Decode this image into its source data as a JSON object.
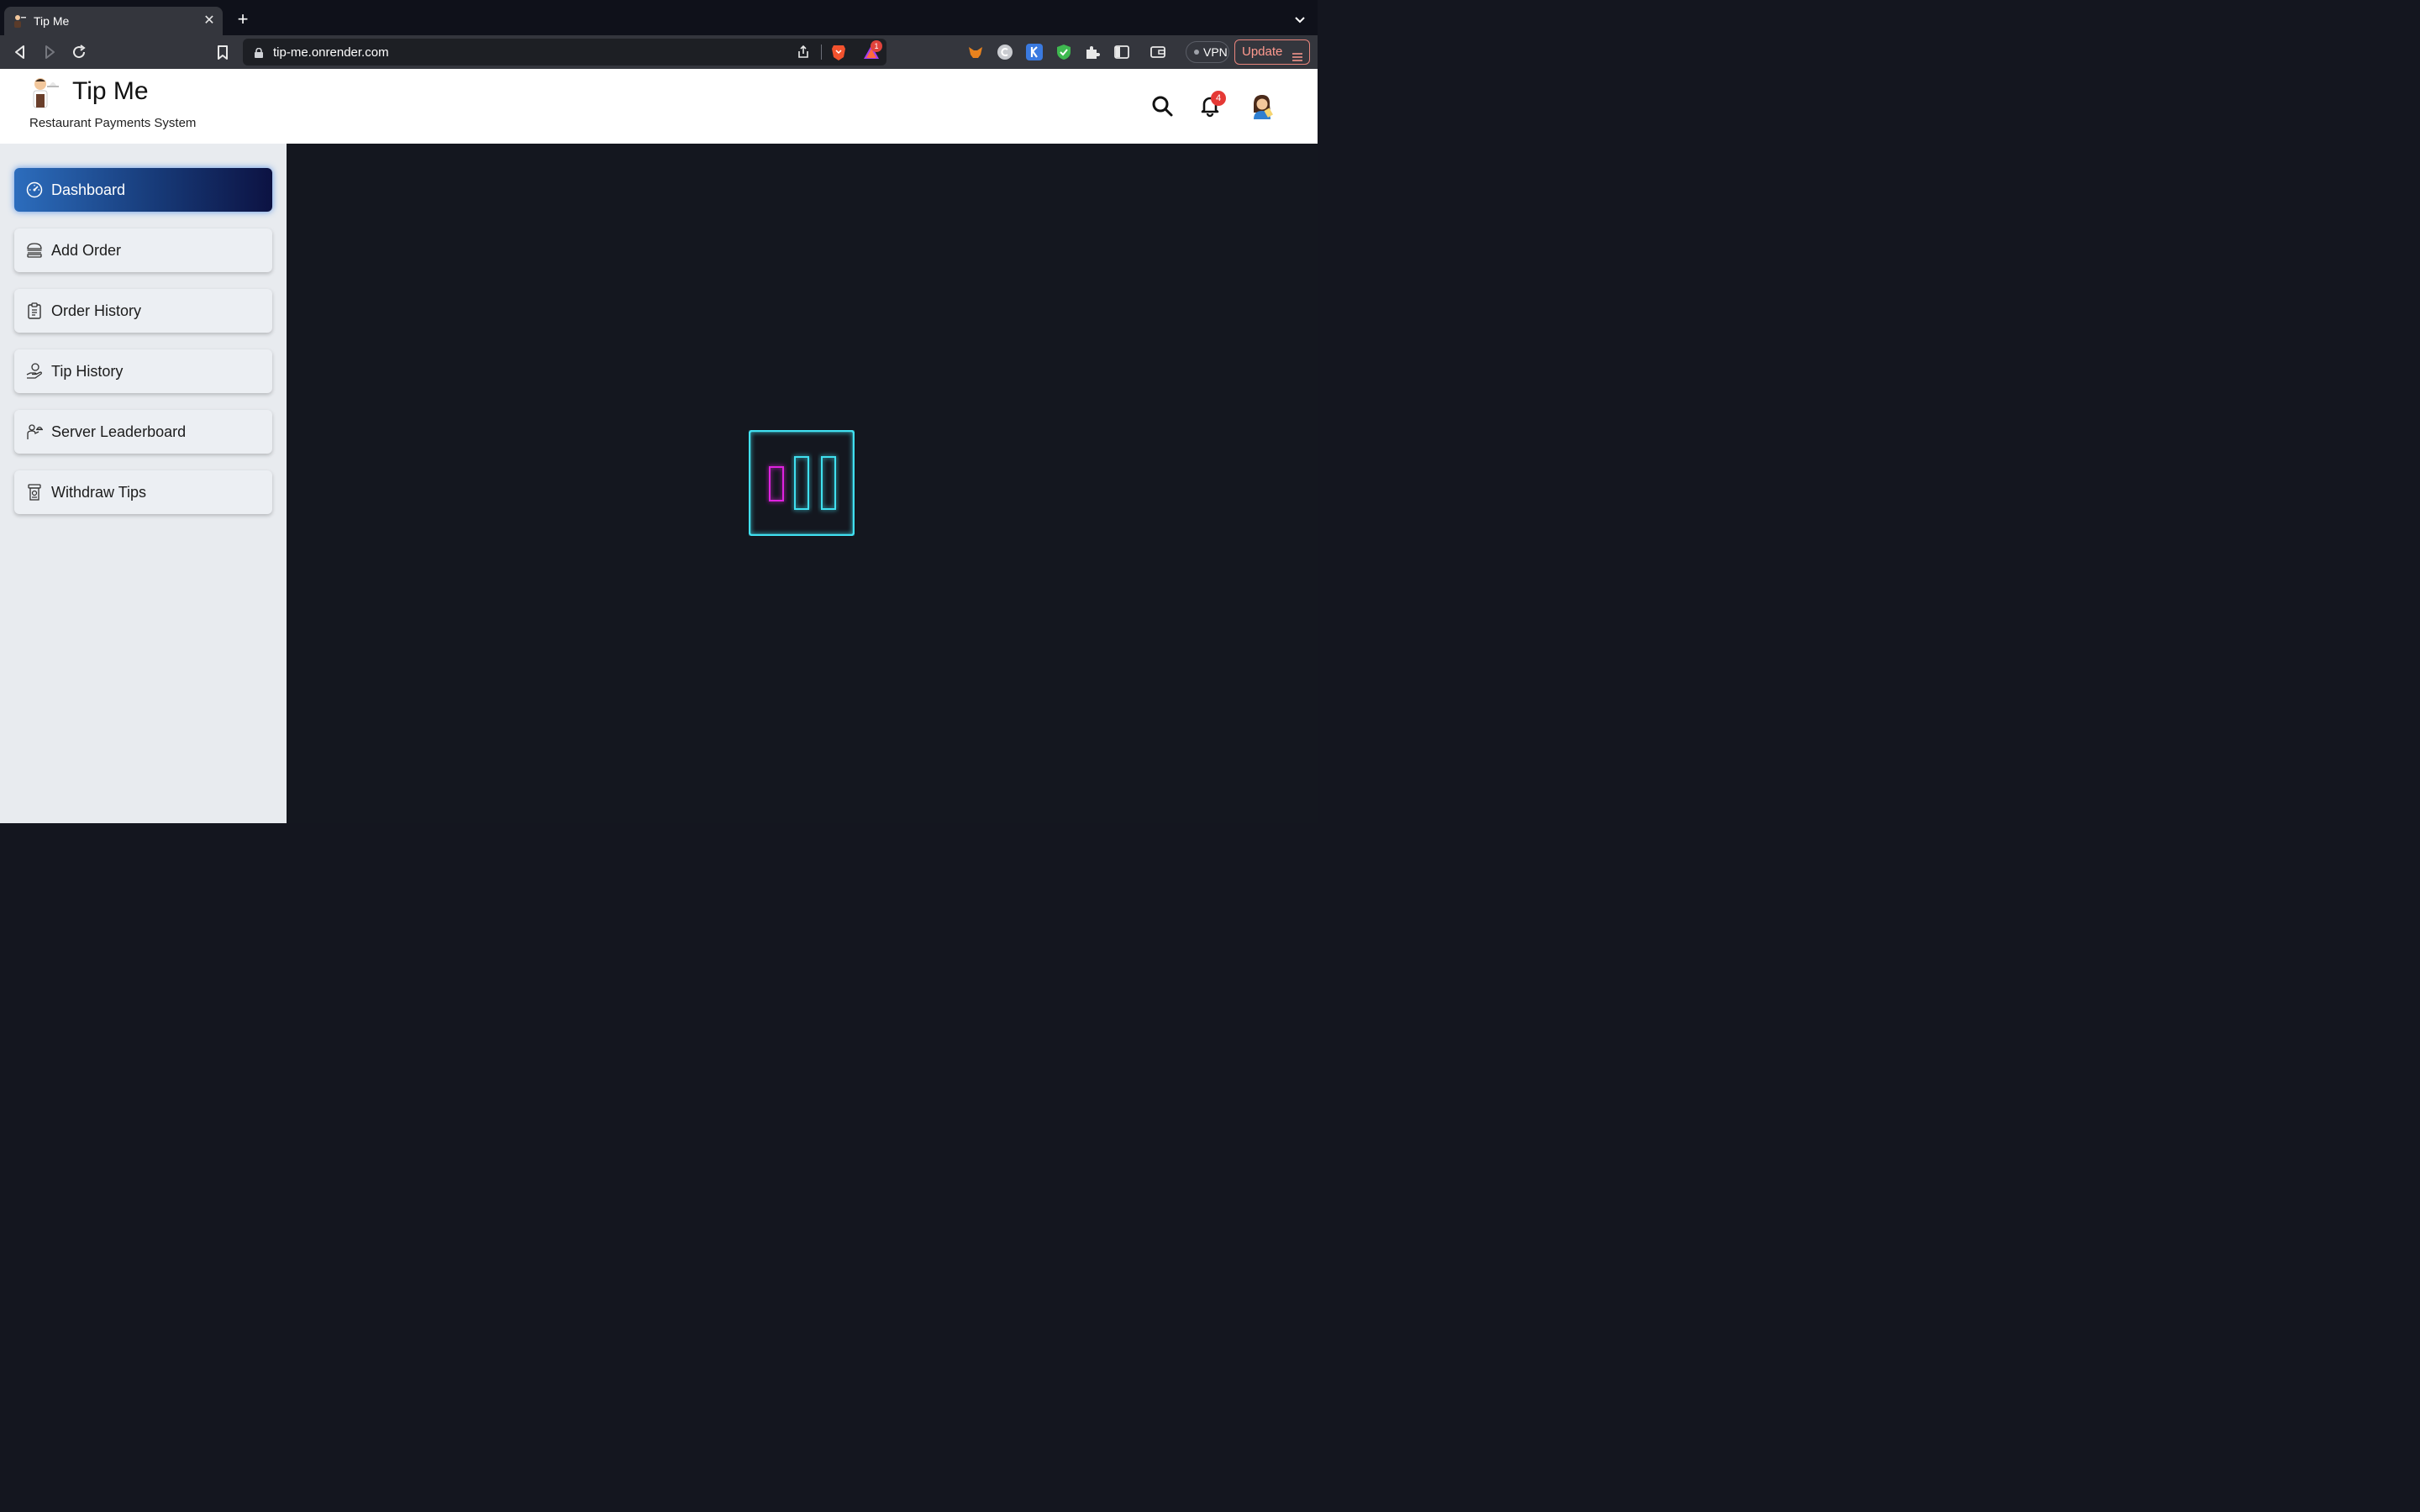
{
  "browser": {
    "tab": {
      "title": "Tip Me"
    },
    "url": "tip-me.onrender.com",
    "rewards_badge": "1",
    "vpn_label": "VPN",
    "update_label": "Update"
  },
  "header": {
    "title": "Tip Me",
    "subtitle": "Restaurant Payments System",
    "notification_count": "4"
  },
  "sidebar": {
    "items": [
      {
        "label": "Dashboard",
        "icon": "speedometer-icon",
        "active": true
      },
      {
        "label": "Add Order",
        "icon": "burger-icon",
        "active": false
      },
      {
        "label": "Order History",
        "icon": "clipboard-icon",
        "active": false
      },
      {
        "label": "Tip History",
        "icon": "hand-coin-icon",
        "active": false
      },
      {
        "label": "Server Leaderboard",
        "icon": "waiter-icon",
        "active": false
      },
      {
        "label": "Withdraw Tips",
        "icon": "atm-icon",
        "active": false
      }
    ]
  },
  "colors": {
    "active_gradient_start": "#2c6dbd",
    "active_gradient_end": "#0c1242",
    "loader_cyan": "#40e0f0",
    "loader_magenta": "#e020e0",
    "badge_red": "#e53935"
  }
}
